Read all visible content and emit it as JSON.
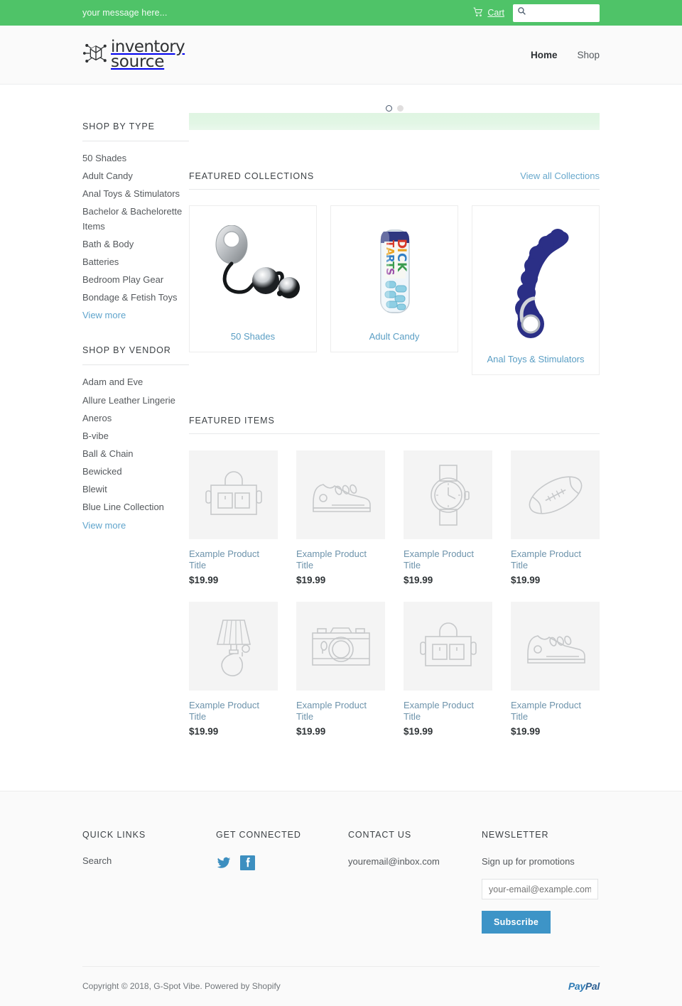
{
  "announcement": {
    "message": "your message here...",
    "cart_label": "Cart",
    "cart_icon": "shopping-cart-icon",
    "search_icon": "search-icon",
    "search_value": "",
    "search_placeholder": "",
    "bar_color": "#4fc368"
  },
  "header": {
    "logo_line1": "inventory",
    "logo_line2": "source",
    "logo_icon": "cube-network-icon",
    "nav": [
      {
        "label": "Home",
        "active": true
      },
      {
        "label": "Shop",
        "active": false
      }
    ]
  },
  "sidebar": {
    "type": {
      "title": "SHOP BY TYPE",
      "items": [
        "50 Shades",
        "Adult Candy",
        "Anal Toys & Stimulators",
        "Bachelor & Bachelorette Items",
        "Bath & Body",
        "Batteries",
        "Bedroom Play Gear",
        "Bondage & Fetish Toys"
      ],
      "more_label": "View more"
    },
    "vendor": {
      "title": "SHOP BY VENDOR",
      "items": [
        "Adam and Eve",
        "Allure Leather Lingerie",
        "Aneros",
        "B-vibe",
        "Ball & Chain",
        "Bewicked",
        "Blewit",
        "Blue Line Collection"
      ],
      "more_label": "View more"
    }
  },
  "hero": {
    "dots": [
      {
        "state": "active"
      },
      {
        "state": "idle"
      }
    ]
  },
  "collections": {
    "title": "FEATURED COLLECTIONS",
    "view_all_label": "View all Collections",
    "items": [
      {
        "label": "50 Shades",
        "image": "silver-kegel-balls-image"
      },
      {
        "label": "Adult Candy",
        "image": "candy-tube-image"
      },
      {
        "label": "Anal Toys & Stimulators",
        "image": "blue-beads-wand-image"
      }
    ]
  },
  "featured_items": {
    "title": "FEATURED ITEMS",
    "items": [
      {
        "title": "Example Product Title",
        "price": "$19.99",
        "icon": "briefcase-icon"
      },
      {
        "title": "Example Product Title",
        "price": "$19.99",
        "icon": "sneaker-icon"
      },
      {
        "title": "Example Product Title",
        "price": "$19.99",
        "icon": "watch-icon"
      },
      {
        "title": "Example Product Title",
        "price": "$19.99",
        "icon": "football-icon"
      },
      {
        "title": "Example Product Title",
        "price": "$19.99",
        "icon": "lamp-icon"
      },
      {
        "title": "Example Product Title",
        "price": "$19.99",
        "icon": "camera-icon"
      },
      {
        "title": "Example Product Title",
        "price": "$19.99",
        "icon": "briefcase-icon"
      },
      {
        "title": "Example Product Title",
        "price": "$19.99",
        "icon": "sneaker-icon"
      }
    ]
  },
  "footer": {
    "quick_links": {
      "title": "QUICK LINKS",
      "items": [
        "Search"
      ]
    },
    "connected": {
      "title": "GET CONNECTED",
      "socials": [
        "twitter-icon",
        "facebook-icon"
      ],
      "color": "#3d8fc0"
    },
    "contact": {
      "title": "CONTACT US",
      "email": "youremail@inbox.com"
    },
    "newsletter": {
      "title": "NEWSLETTER",
      "description": "Sign up for promotions",
      "input_value": "",
      "input_placeholder": "your-email@example.com",
      "button_label": "Subscribe",
      "button_color": "#3d94c7"
    },
    "copyright": "Copyright © 2018, G-Spot Vibe. Powered by Shopify",
    "payment_pay": "Pay",
    "payment_pal": "Pal"
  }
}
